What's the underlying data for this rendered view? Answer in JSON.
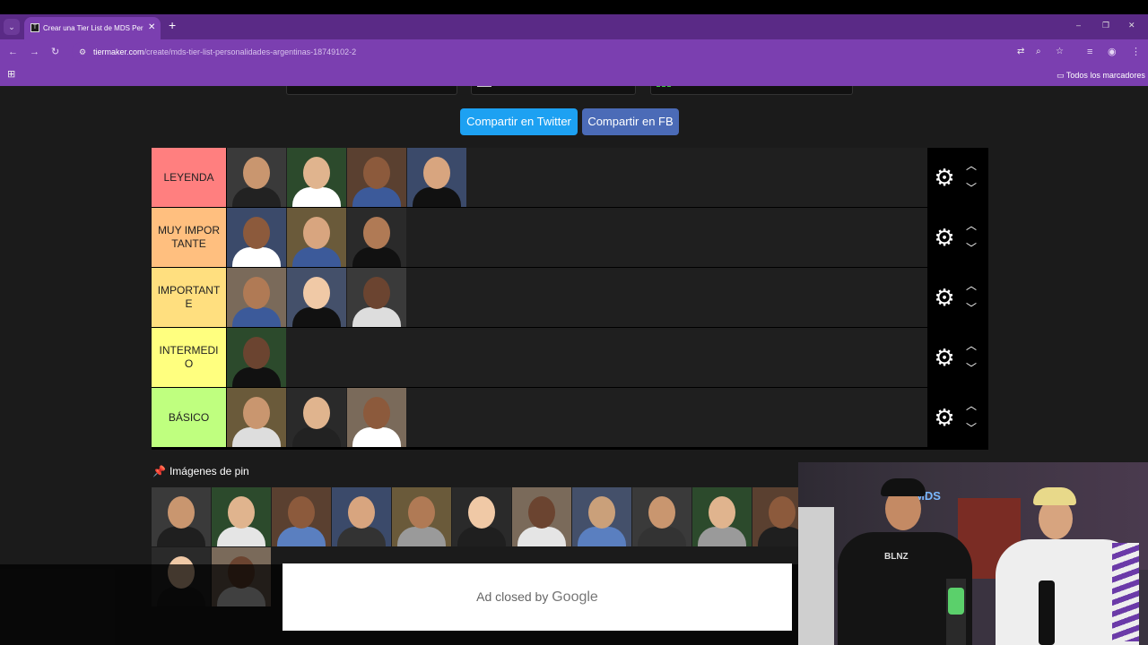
{
  "browser": {
    "tab": {
      "title": "Crear una Tier List de MDS Personalidades Argentinas",
      "close": "✕"
    },
    "new_tab": "+",
    "window_controls": [
      "–",
      "❐",
      "✕"
    ],
    "nav": {
      "back": "←",
      "forward": "→",
      "reload": "↻"
    },
    "url_host": "tiermaker.com",
    "url_path": "/create/mds-tier-list-personalidades-argentinas-18749102-2",
    "bookmarks_folder": "Todos los marcadores"
  },
  "share": {
    "twitter": "Compartir en Twitter",
    "facebook": "Compartir en FB"
  },
  "tiers": [
    {
      "label": "LEYENDA",
      "color": "#ff7f7f",
      "count": 4
    },
    {
      "label": "MUY IMPORTANTE",
      "color": "#ffbf7f",
      "count": 3
    },
    {
      "label": "IMPORTANTE",
      "color": "#ffdf7f",
      "count": 3
    },
    {
      "label": "INTERMEDIO",
      "color": "#ffff7f",
      "count": 1
    },
    {
      "label": "BÁSICO",
      "color": "#bfff7f",
      "count": 3
    }
  ],
  "pin": {
    "title": "Imágenes de pin",
    "count_row1": 11,
    "count_row2": 2
  },
  "ad": {
    "text": "Ad closed by",
    "brand": "Google"
  },
  "webcam": {
    "shirt_text": "BLNZ",
    "sign": "MDS"
  }
}
